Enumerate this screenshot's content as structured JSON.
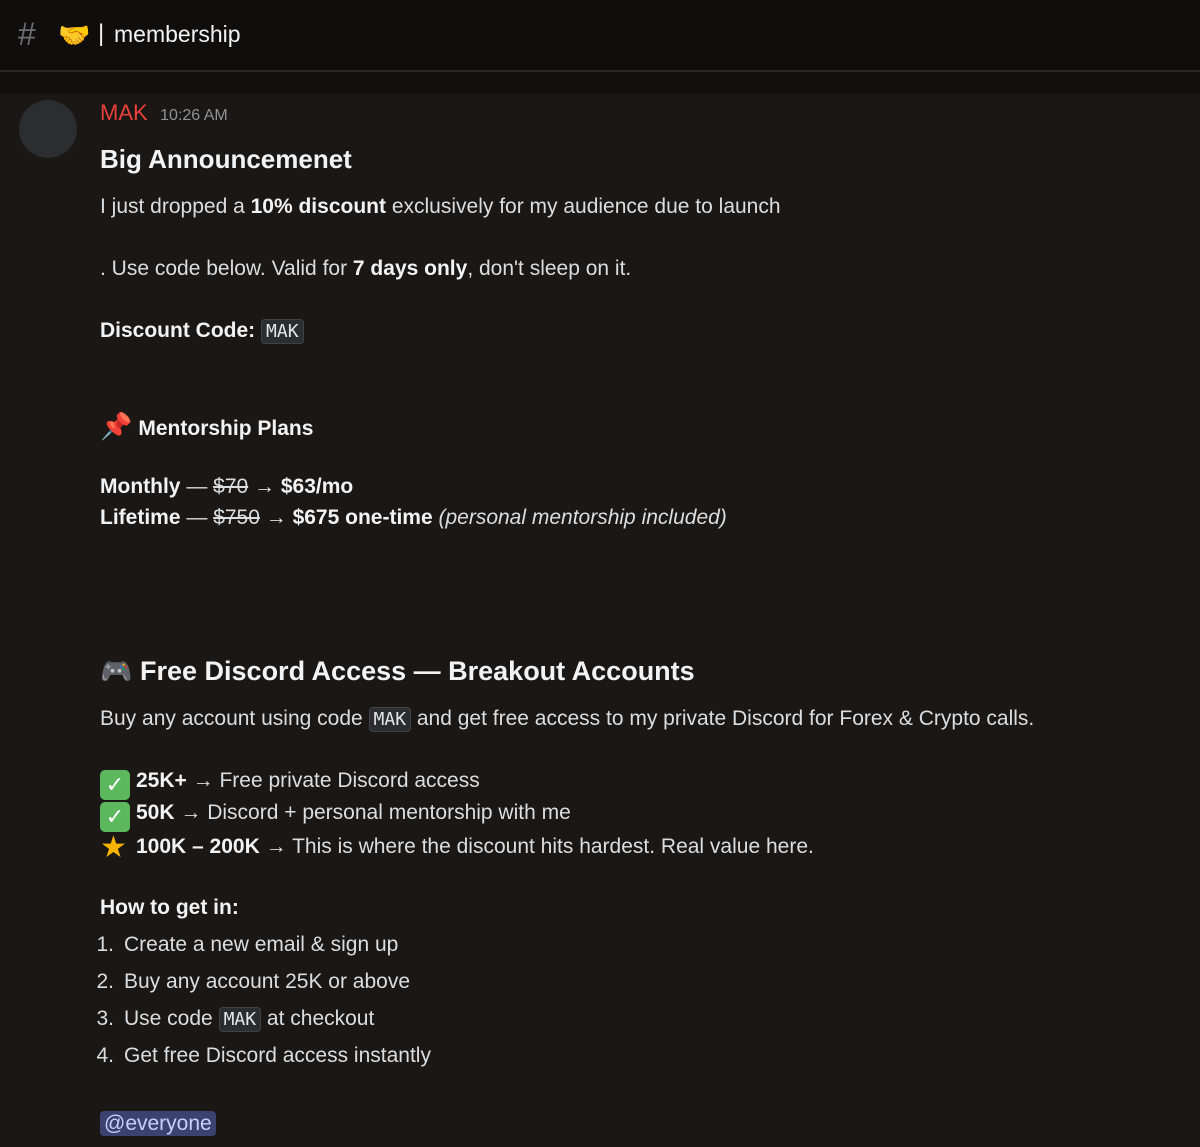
{
  "header": {
    "hash_icon": "#",
    "emoji": "🤝",
    "separator": "|",
    "channel_name": "membership"
  },
  "message": {
    "author": "MAK",
    "timestamp": "10:26 AM",
    "title": "Big Announcemenet",
    "intro": {
      "pre": "I just dropped a ",
      "bold": "10% discount",
      "post": " exclusively for my audience due to launch"
    },
    "valid": {
      "pre": ". Use code below. Valid for ",
      "bold": "7 days only",
      "post": ", don't sleep on it."
    },
    "discount": {
      "label": "Discount Code:",
      "code": "MAK"
    },
    "plans": {
      "emoji": "📌",
      "heading": "Mentorship Plans",
      "monthly": {
        "name": "Monthly",
        "dash": " — ",
        "old": "$70",
        "arrow": " → ",
        "new": "$63/mo"
      },
      "lifetime": {
        "name": "Lifetime",
        "dash": " — ",
        "old": "$750",
        "arrow": " → ",
        "new": "$675 one-time",
        "note": " (personal mentorship included)"
      }
    },
    "free": {
      "emoji": "🎮",
      "heading": "Free Discord Access — Breakout Accounts",
      "desc_pre": "Buy any account using code ",
      "desc_code": "MAK",
      "desc_post": " and get free access to my private Discord for Forex & Crypto calls.",
      "tiers": [
        {
          "icon": "✓",
          "bold": "25K+",
          "arrow": " → ",
          "text": "Free private Discord access"
        },
        {
          "icon": "✓",
          "bold": "50K",
          "arrow": " → ",
          "text": "Discord + personal mentorship with me"
        },
        {
          "icon": "★",
          "bold": "100K – 200K",
          "arrow": " → ",
          "text": "This is where the discount hits hardest. Real value here."
        }
      ]
    },
    "howto": {
      "heading": "How to get in:",
      "steps": [
        {
          "num": "1.",
          "text": "Create a new email & sign up"
        },
        {
          "num": "2.",
          "text": "Buy any account 25K or above"
        },
        {
          "num": "3.",
          "pre": "Use code ",
          "code": "MAK",
          "post": " at checkout"
        },
        {
          "num": "4.",
          "text": "Get free Discord access instantly"
        }
      ]
    },
    "mention": "@everyone"
  },
  "colors": {
    "background": "#1a1714",
    "author": "#e8403c",
    "mention_bg": "#3c4270",
    "check": "#5cb85c",
    "star": "#f4b400"
  }
}
